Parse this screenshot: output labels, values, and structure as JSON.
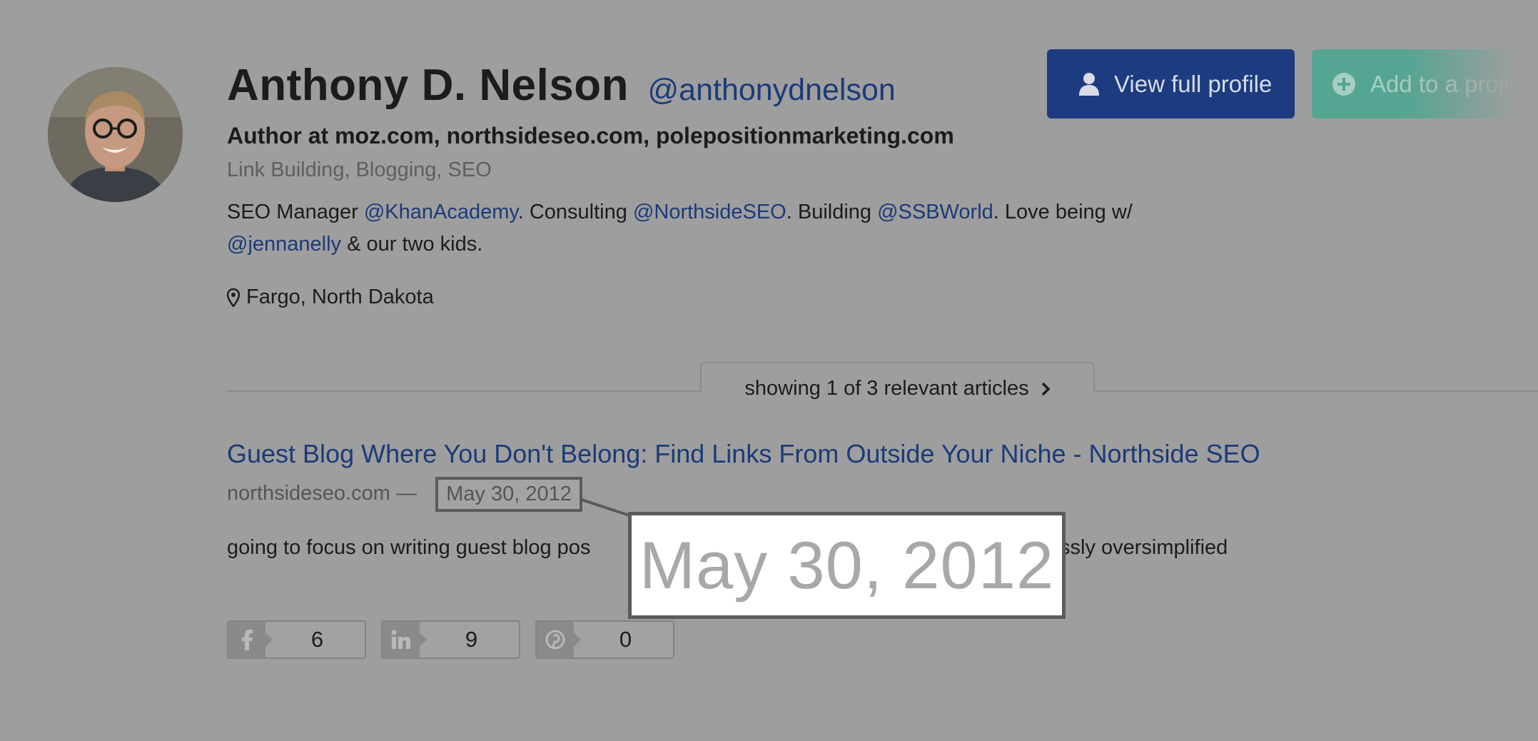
{
  "profile": {
    "name": "Anthony D. Nelson",
    "handle": "@anthonydnelson",
    "headline": "Author at moz.com, northsideseo.com, polepositionmarketing.com",
    "tags": "Link Building, Blogging, SEO",
    "bio": {
      "t1": "SEO Manager ",
      "m1": "@KhanAcademy",
      "t2": ". Consulting ",
      "m2": "@NorthsideSEO",
      "t3": ". Building ",
      "m3": "@SSBWorld",
      "t4": ". Love being w/ ",
      "m4": "@jennanelly",
      "t5": " & our two kids."
    },
    "location": "Fargo, North Dakota"
  },
  "actions": {
    "view_profile": "View full profile",
    "add_to": "Add to a project"
  },
  "articles": {
    "tab_label": "showing 1 of 3 relevant articles",
    "title": "Guest Blog Where You Don't Belong: Find Links From Outside Your Niche - Northside SEO",
    "source": "northsideseo.com —",
    "date": "May 30, 2012",
    "snippet_left": "going to focus on writing guest blog pos",
    "snippet_right": "ssly oversimplified",
    "zoom_date": "May 30, 2012",
    "shares": {
      "facebook": "6",
      "linkedin": "9",
      "pinterest": "0"
    }
  },
  "icons": {
    "avatar": "avatar-photo",
    "view_profile": "user-icon",
    "add_to": "plus-circle-icon",
    "location": "map-pin-icon",
    "next": "chevron-right-icon",
    "facebook": "facebook-icon",
    "linkedin": "linkedin-icon",
    "pinterest": "pinterest-icon"
  },
  "colors": {
    "overlay": "#9e9e9e",
    "link": "#1b3b78",
    "primary_button": "#1d3b80",
    "secondary_button": "#54a592"
  }
}
